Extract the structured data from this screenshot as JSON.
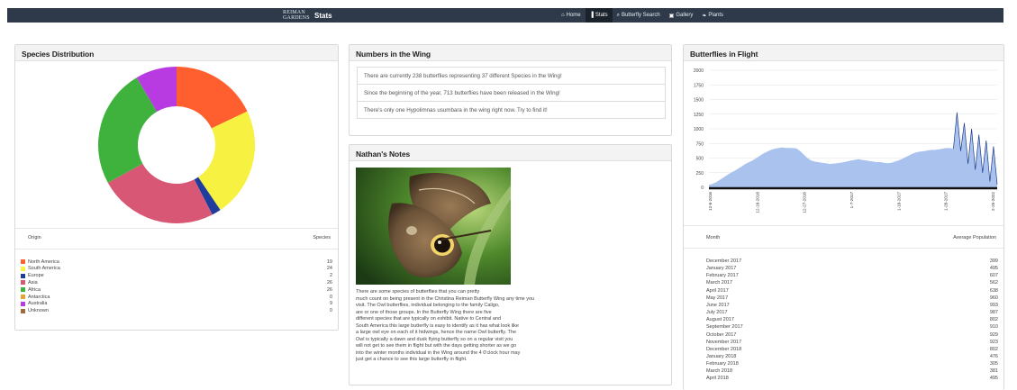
{
  "nav": {
    "brand_logo_line1": "REIMAN",
    "brand_logo_line2": "GARDENS",
    "brand_title": "Stats",
    "items": [
      {
        "label": "Home",
        "icon": "home-icon",
        "glyph": "⌂"
      },
      {
        "label": "Stats",
        "icon": "bar-chart-icon",
        "glyph": "▐"
      },
      {
        "label": "Butterfly Search",
        "icon": "search-icon",
        "glyph": "⌕"
      },
      {
        "label": "Gallery",
        "icon": "image-icon",
        "glyph": "▣"
      },
      {
        "label": "Plants",
        "icon": "leaf-icon",
        "glyph": "❧"
      }
    ],
    "active_index": 1
  },
  "species": {
    "title": "Species Distribution",
    "col_origin": "Origin",
    "col_species": "Species",
    "rows": [
      {
        "origin": "North America",
        "count": "19",
        "color": "#ff5f2e"
      },
      {
        "origin": "South America",
        "count": "24",
        "color": "#f7f142"
      },
      {
        "origin": "Europe",
        "count": "2",
        "color": "#1f3d9c"
      },
      {
        "origin": "Asia",
        "count": "26",
        "color": "#d85774"
      },
      {
        "origin": "Africa",
        "count": "26",
        "color": "#3fb23d"
      },
      {
        "origin": "Antarctica",
        "count": "0",
        "color": "#e3a434"
      },
      {
        "origin": "Australia",
        "count": "9",
        "color": "#b83be2"
      },
      {
        "origin": "Unknown",
        "count": "0",
        "color": "#a06a3a"
      }
    ]
  },
  "numbers": {
    "title": "Numbers in the Wing",
    "items": [
      "There are currently 238 butterflies representing 37 different Species in the Wing!",
      "Since the beginning of the year, 713 butterflies have been released in the Wing!",
      "There's only one Hypolimnas usumbara in the wing right now. Try to find it!"
    ]
  },
  "notes": {
    "title": "Nathan's Notes",
    "lines": [
      "There are some species of butterflies that you can pretty",
      "much count on being present in the Christina Reiman Butterfly Wing any time you",
      "visit.  The Owl butterflies, individual belonging to the family Caligo,",
      "are or one of those groups.  In the Butterfly Wing there are five",
      "different species that are typically on exhibit.  Native to Central and",
      "South America this large butterfly is easy to identify as it has what look like",
      "a large owl eye on each of it hidwings, hence the name Owl butterfly.  The",
      "Owl is typically a dawn and dusk flying butterfly so on a regular visit you",
      "will not get to see them in flight but with the days getting shorter as we go",
      "into the winter months individual in the Wing around the 4 0'clock hour may",
      "just get a chance to see this large butterfly in flight."
    ]
  },
  "flight": {
    "title": "Butterflies in Flight",
    "col_month": "Month",
    "col_avg": "Average Population",
    "rows": [
      {
        "month": "December 2017",
        "avg": "399"
      },
      {
        "month": "January 2017",
        "avg": "495"
      },
      {
        "month": "February 2017",
        "avg": "607"
      },
      {
        "month": "March 2017",
        "avg": "562"
      },
      {
        "month": "April 2017",
        "avg": "638"
      },
      {
        "month": "May 2017",
        "avg": "960"
      },
      {
        "month": "June 2017",
        "avg": "993"
      },
      {
        "month": "July 2017",
        "avg": "987"
      },
      {
        "month": "August 2017",
        "avg": "802"
      },
      {
        "month": "September 2017",
        "avg": "910"
      },
      {
        "month": "October 2017",
        "avg": "929"
      },
      {
        "month": "November 2017",
        "avg": "923"
      },
      {
        "month": "December 2018",
        "avg": "802"
      },
      {
        "month": "January 2018",
        "avg": "476"
      },
      {
        "month": "February 2018",
        "avg": "305"
      },
      {
        "month": "March 2018",
        "avg": "381"
      },
      {
        "month": "April 2018",
        "avg": "495"
      }
    ]
  },
  "chart_data": [
    {
      "type": "pie",
      "donut": true,
      "categories": [
        "North America",
        "South America",
        "Europe",
        "Asia",
        "Africa",
        "Antarctica",
        "Australia",
        "Unknown"
      ],
      "values": [
        19,
        24,
        2,
        26,
        26,
        0,
        9,
        0
      ],
      "colors": [
        "#ff5f2e",
        "#f7f142",
        "#1f3d9c",
        "#d85774",
        "#3fb23d",
        "#e3a434",
        "#b83be2",
        "#a06a3a"
      ]
    },
    {
      "type": "area",
      "ylim": [
        0,
        2000
      ],
      "yticks": [
        0,
        250,
        500,
        750,
        1000,
        1250,
        1500,
        1750,
        2000
      ],
      "xtick_labels": [
        "12-6-2016",
        "12-16-2016",
        "12-27-2016",
        "1-7-2017",
        "1-18-2017",
        "1-28-2017",
        "2-25-2022"
      ],
      "grid": true,
      "color": "#a9c3ee",
      "line_color": "#1f3a8a",
      "values": [
        40,
        60,
        90,
        130,
        170,
        210,
        250,
        280,
        320,
        360,
        400,
        430,
        460,
        500,
        540,
        580,
        610,
        640,
        660,
        670,
        680,
        675,
        670,
        670,
        665,
        620,
        560,
        500,
        460,
        440,
        430,
        420,
        410,
        400,
        405,
        410,
        420,
        430,
        445,
        460,
        470,
        480,
        470,
        460,
        450,
        440,
        430,
        430,
        420,
        410,
        420,
        440,
        460,
        490,
        520,
        550,
        580,
        600,
        610,
        620,
        630,
        640,
        640,
        650,
        660,
        670,
        670,
        660,
        1280,
        620,
        1100,
        400,
        1000,
        300,
        900,
        250,
        800,
        100,
        700,
        50
      ]
    }
  ]
}
